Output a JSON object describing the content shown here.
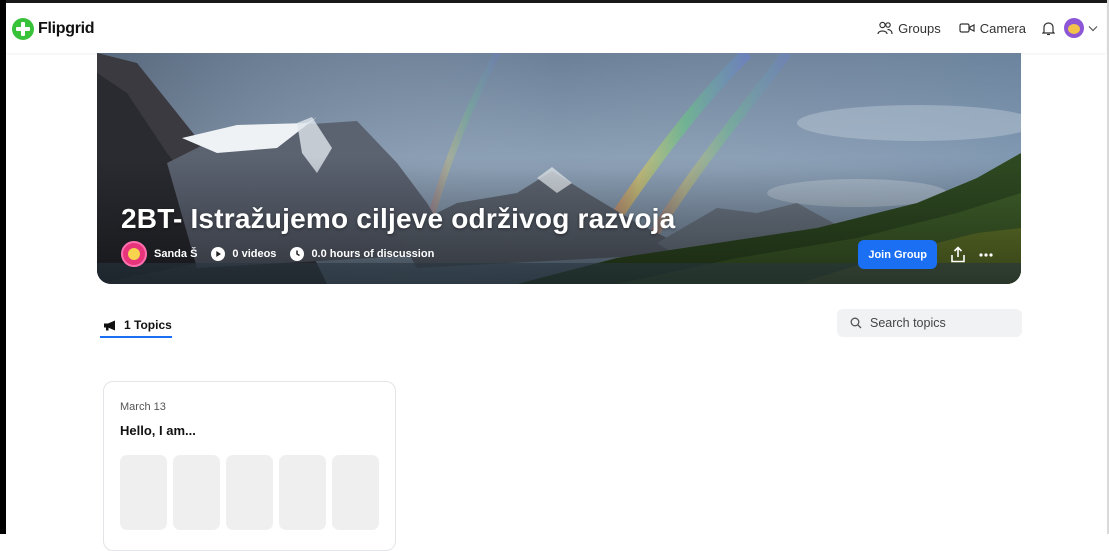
{
  "app": {
    "logo_text": "Flipgrid"
  },
  "nav": {
    "groups_label": "Groups",
    "camera_label": "Camera"
  },
  "group": {
    "title": "2BT- Istražujemo ciljeve održivog razvoja",
    "owner_name": "Sanda Š",
    "videos": "0 videos",
    "discussion": "0.0 hours of discussion",
    "join_label": "Join Group",
    "more_label": "···"
  },
  "topics": {
    "tab_label": "1 Topics",
    "search_placeholder": "Search topics",
    "items": [
      {
        "date": "March 13",
        "title": "Hello, I am..."
      }
    ]
  },
  "colors": {
    "accent": "#1a6ff2",
    "logo_green": "#38c23a"
  },
  "icons": [
    "flipgrid-logo-icon",
    "groups-icon",
    "camera-icon",
    "bell-icon",
    "chevron-down-icon",
    "play-icon",
    "clock-icon",
    "share-icon",
    "more-icon",
    "megaphone-icon",
    "search-icon"
  ]
}
